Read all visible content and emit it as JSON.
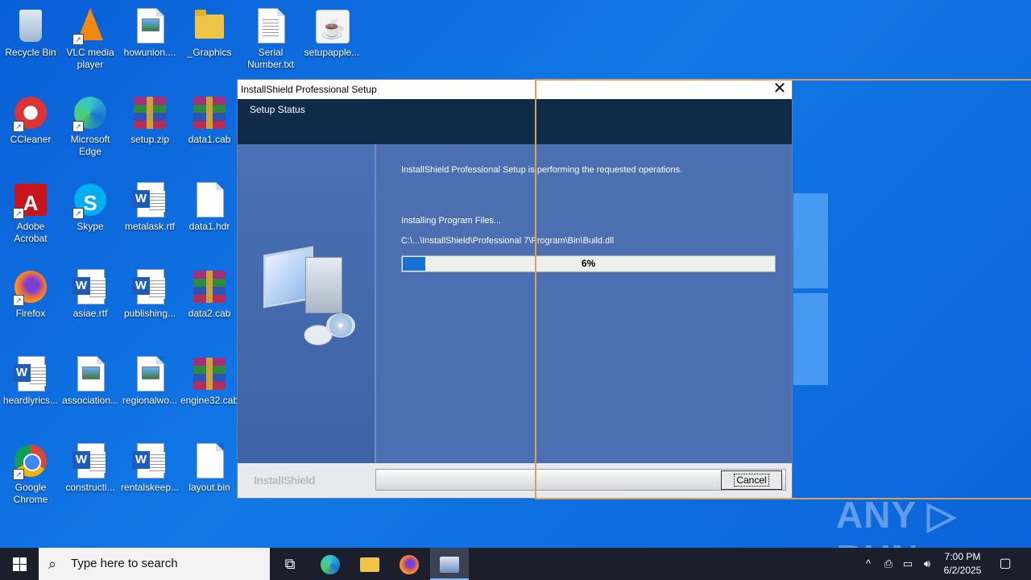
{
  "desktop": {
    "icons": [
      {
        "label": "Recycle Bin"
      },
      {
        "label": "VLC media player"
      },
      {
        "label": "howunion...."
      },
      {
        "label": "_Graphics"
      },
      {
        "label": "Serial Number.txt"
      },
      {
        "label": "setupapple..."
      },
      {
        "label": "CCleaner"
      },
      {
        "label": "Microsoft Edge"
      },
      {
        "label": "setup.zip"
      },
      {
        "label": "data1.cab"
      },
      {
        "label": "Adobe Acrobat"
      },
      {
        "label": "Skype"
      },
      {
        "label": "metalask.rtf"
      },
      {
        "label": "data1.hdr"
      },
      {
        "label": "Firefox"
      },
      {
        "label": "asiae.rtf"
      },
      {
        "label": "publishing..."
      },
      {
        "label": "data2.cab"
      },
      {
        "label": "heardlyrics..."
      },
      {
        "label": "association..."
      },
      {
        "label": "regionalwo..."
      },
      {
        "label": "engine32.cab"
      },
      {
        "label": "Google Chrome"
      },
      {
        "label": "constructi..."
      },
      {
        "label": "rentalskeep..."
      },
      {
        "label": "layout.bin"
      }
    ]
  },
  "installer": {
    "title": "InstallShield Professional Setup",
    "close_glyph": "✕",
    "header_title": "Setup Status",
    "message": "InstallShield Professional Setup is performing the requested operations.",
    "status": "Installing Program Files...",
    "file_path": "C:\\...\\InstallShield\\Professional 7\\Program\\Bin\\Build.dll",
    "progress_percent": 6,
    "progress_label": "6%",
    "brand": "InstallShield",
    "cancel_label": "Cancel"
  },
  "watermark": "ANY ▷ RUN",
  "taskbar": {
    "search_placeholder": "Type here to search",
    "time": "7:00 PM",
    "date": "6/2/2025",
    "pinned": [
      "task-view-icon",
      "edge-icon",
      "file-explorer-icon",
      "firefox-icon",
      "installer-icon"
    ]
  },
  "colors": {
    "desktop": "#0b63d8",
    "installer_header": "#102a4a",
    "progress_fill": "#1772d6",
    "overlay": "#d9a05a"
  }
}
